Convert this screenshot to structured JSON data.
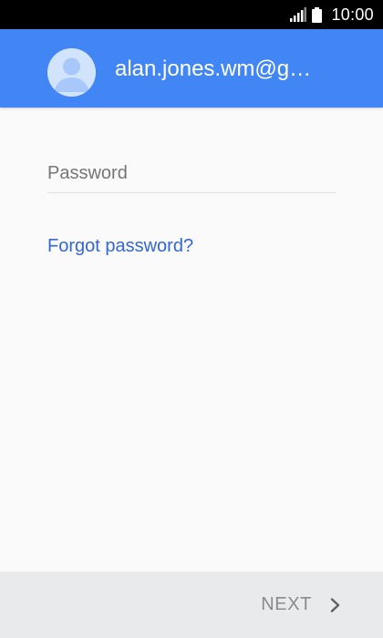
{
  "status_bar": {
    "time": "10:00",
    "icons": [
      "signal-icon",
      "battery-icon"
    ]
  },
  "account_header": {
    "email": "alan.jones.wm@g…",
    "avatar_icon": "person-icon",
    "background_color": "#4285f4"
  },
  "password_field": {
    "placeholder": "Password",
    "value": ""
  },
  "forgot_password": {
    "label": "Forgot password?"
  },
  "footer": {
    "next_label": "NEXT",
    "next_icon": "chevron-right-icon"
  },
  "colors": {
    "link": "#3367d6",
    "status_bar": "#000000",
    "footer": "#e9eaec"
  }
}
